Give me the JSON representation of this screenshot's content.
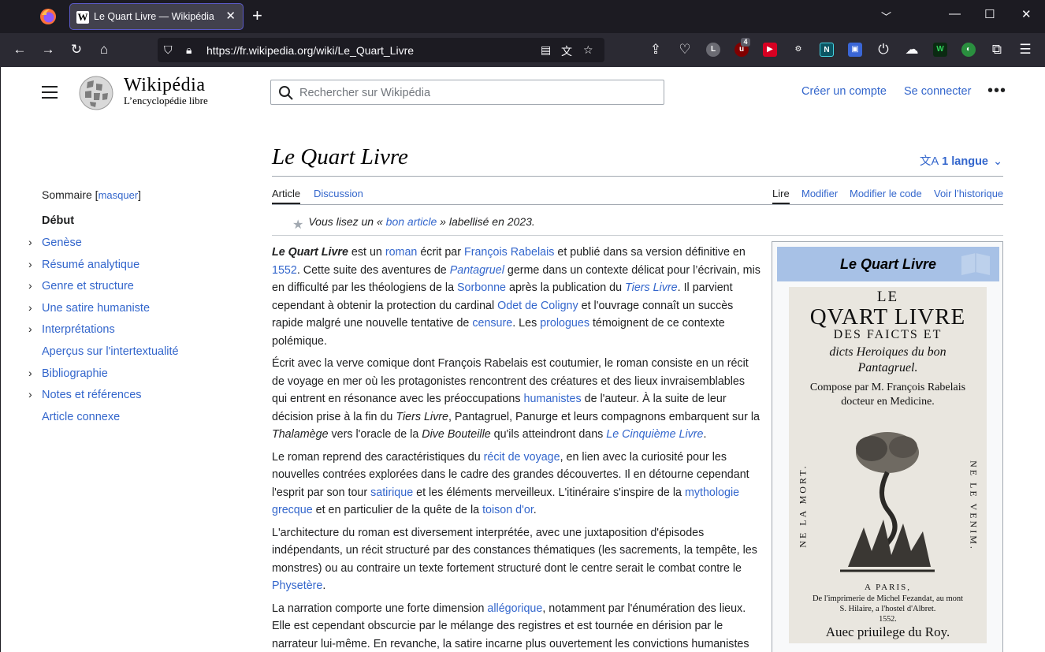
{
  "browser": {
    "tab_title": "Le Quart Livre — Wikipédia",
    "url": "https://fr.wikipedia.org/wiki/Le_Quart_Livre",
    "extension_badge": "4"
  },
  "header": {
    "wordmark": "Wikipédia",
    "tagline": "L’encyclopédie libre",
    "search_placeholder": "Rechercher sur Wikipédia",
    "create_account": "Créer un compte",
    "login": "Se connecter"
  },
  "article": {
    "title": "Le Quart Livre",
    "languages": "1 langue",
    "tabs_left": [
      "Article",
      "Discussion"
    ],
    "tabs_right": [
      "Lire",
      "Modifier",
      "Modifier le code",
      "Voir l’historique"
    ],
    "good_article_notice": {
      "before": "Vous lisez un « ",
      "link": "bon article",
      "after": " » labellisé en 2023."
    }
  },
  "toc": {
    "title": "Sommaire",
    "toggle": "masquer",
    "items": [
      {
        "label": "Début",
        "expandable": false
      },
      {
        "label": "Genèse",
        "expandable": true
      },
      {
        "label": "Résumé analytique",
        "expandable": true
      },
      {
        "label": "Genre et structure",
        "expandable": true
      },
      {
        "label": "Une satire humaniste",
        "expandable": true
      },
      {
        "label": "Interprétations",
        "expandable": true
      },
      {
        "label": "Aperçus sur l'intertextualité",
        "expandable": false
      },
      {
        "label": "Bibliographie",
        "expandable": true
      },
      {
        "label": "Notes et références",
        "expandable": true
      },
      {
        "label": "Article connexe",
        "expandable": false
      }
    ]
  },
  "infobox": {
    "title": "Le Quart Livre",
    "cover_text": {
      "l1": "LE",
      "l2": "QVART LIVRE",
      "l3": "DES FAICTS ET",
      "l4": "dicts Heroiques du bon",
      "l5": "Pantagruel.",
      "l6": "Compose par M. François Rabelais",
      "l7": "docteur en Medicine.",
      "left_side": "NE LA MORT.",
      "right_side": "NE LE VENIM.",
      "l8": "A PARIS,",
      "l9": "De l'imprimerie de Michel Fezandat, au mont",
      "l10": "S. Hilaire, a l'hostel d'Albret.",
      "l11": "1552.",
      "l12": "Auec priuilege du Roy."
    }
  },
  "colors": {
    "link": "#3366cc",
    "text": "#202122",
    "infobox_header": "#a7c1e6",
    "chrome_dark": "#1c1b22",
    "chrome_toolbar": "#2b2a33"
  }
}
